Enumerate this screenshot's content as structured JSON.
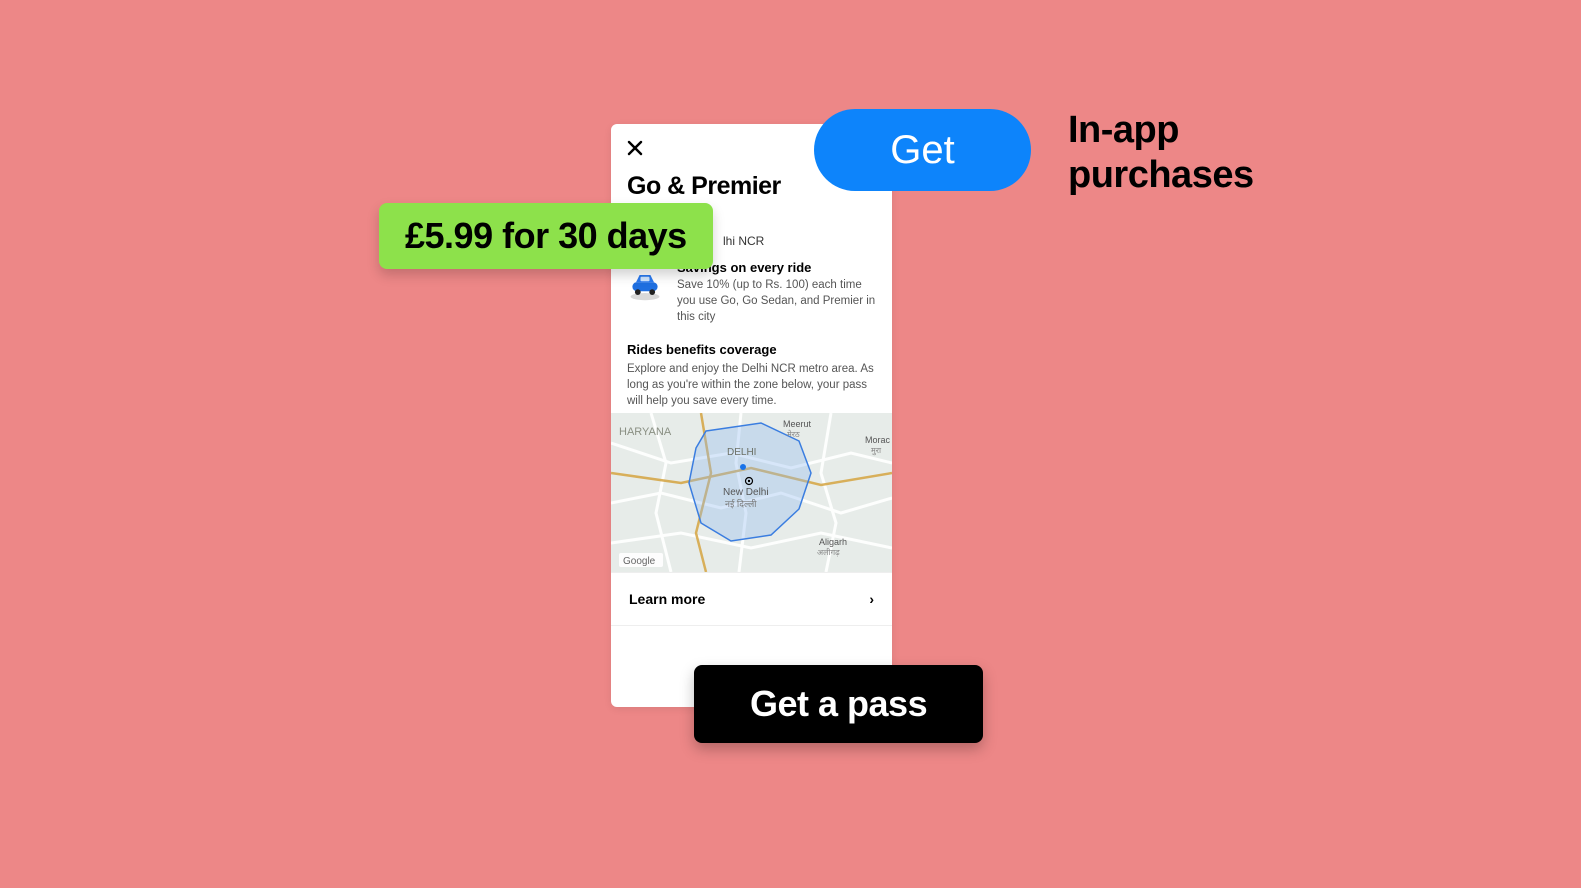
{
  "phone": {
    "title": "Go & Premier",
    "subtitle_suffix": "lhi NCR",
    "benefit": {
      "title": "Savings on every ride",
      "body": "Save 10% (up to Rs. 100) each time you use Go, Go Sedan, and Premier in this city"
    },
    "coverage": {
      "title": "Rides benefits coverage",
      "body": "Explore and enjoy the Delhi NCR metro area. As long as you're within the zone below, your pass will help you save every time."
    },
    "map_labels": {
      "haryana": "HARYANA",
      "delhi": "DELHI",
      "new_delhi": "New Delhi",
      "new_delhi_hi": "नई दिल्ली",
      "meerut": "Meerut",
      "meerut_hi": "मेरठ",
      "aligarh": "Aligarh",
      "aligarh_hi": "अलीगढ़",
      "morad": "Morac",
      "morad_hi": "मुरा",
      "google": "Google"
    },
    "learn_more": "Learn more"
  },
  "price_pill": "£5.99 for 30 days",
  "get_button": "Get",
  "inapp_label": "In-app\npurchases",
  "get_pass_button": "Get a pass"
}
